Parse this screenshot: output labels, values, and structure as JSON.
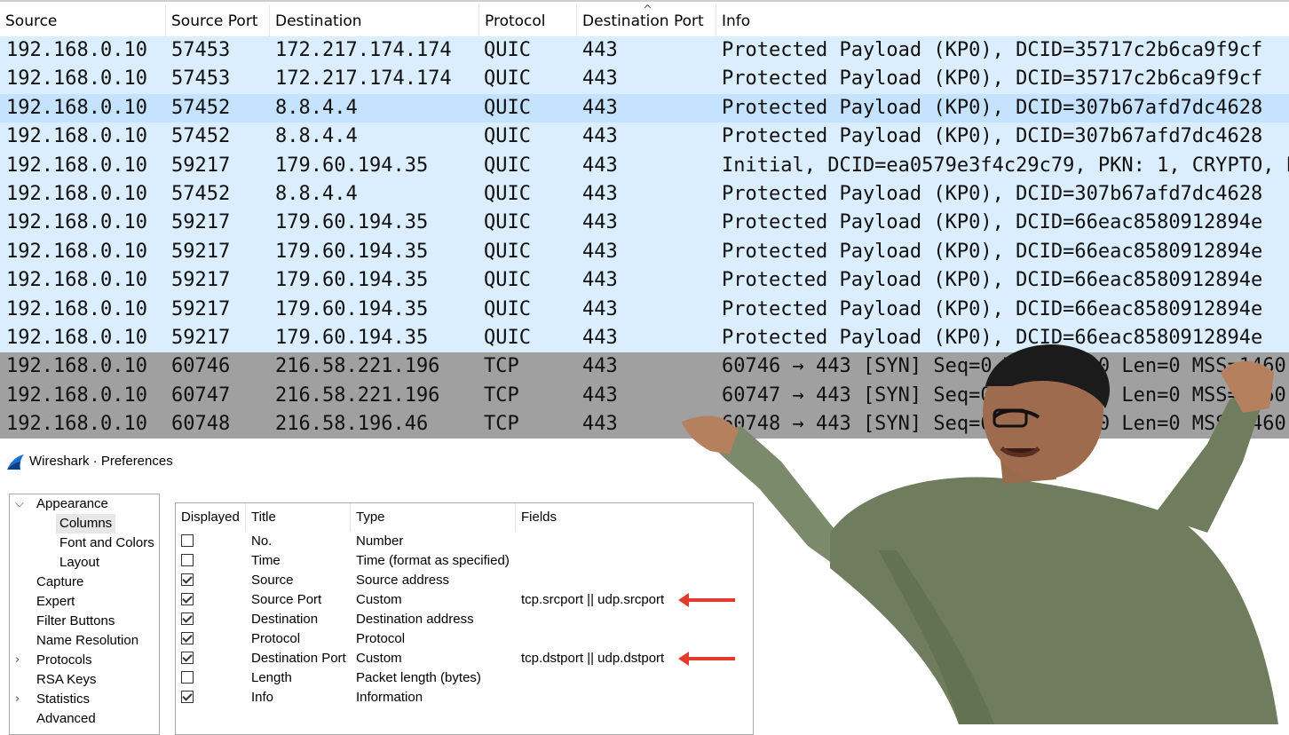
{
  "packet_list": {
    "columns": [
      "Source",
      "Source Port",
      "Destination",
      "Protocol",
      "Destination Port",
      "Info"
    ],
    "sort_indicator": "^",
    "rows": [
      {
        "source": "192.168.0.10",
        "source_port": "57453",
        "destination": "172.217.174.174",
        "protocol": "QUIC",
        "destination_port": "443",
        "info": "Protected Payload (KP0), DCID=35717c2b6ca9f9cf",
        "kind": "quic"
      },
      {
        "source": "192.168.0.10",
        "source_port": "57453",
        "destination": "172.217.174.174",
        "protocol": "QUIC",
        "destination_port": "443",
        "info": "Protected Payload (KP0), DCID=35717c2b6ca9f9cf",
        "kind": "quic"
      },
      {
        "source": "192.168.0.10",
        "source_port": "57452",
        "destination": "8.8.4.4",
        "protocol": "QUIC",
        "destination_port": "443",
        "info": "Protected Payload (KP0), DCID=307b67afd7dc4628",
        "kind": "quic-sel"
      },
      {
        "source": "192.168.0.10",
        "source_port": "57452",
        "destination": "8.8.4.4",
        "protocol": "QUIC",
        "destination_port": "443",
        "info": "Protected Payload (KP0), DCID=307b67afd7dc4628",
        "kind": "quic"
      },
      {
        "source": "192.168.0.10",
        "source_port": "59217",
        "destination": "179.60.194.35",
        "protocol": "QUIC",
        "destination_port": "443",
        "info": "Initial, DCID=ea0579e3f4c29c79, PKN: 1, CRYPTO, P",
        "kind": "quic"
      },
      {
        "source": "192.168.0.10",
        "source_port": "57452",
        "destination": "8.8.4.4",
        "protocol": "QUIC",
        "destination_port": "443",
        "info": "Protected Payload (KP0), DCID=307b67afd7dc4628",
        "kind": "quic"
      },
      {
        "source": "192.168.0.10",
        "source_port": "59217",
        "destination": "179.60.194.35",
        "protocol": "QUIC",
        "destination_port": "443",
        "info": "Protected Payload (KP0), DCID=66eac8580912894e",
        "kind": "quic"
      },
      {
        "source": "192.168.0.10",
        "source_port": "59217",
        "destination": "179.60.194.35",
        "protocol": "QUIC",
        "destination_port": "443",
        "info": "Protected Payload (KP0), DCID=66eac8580912894e",
        "kind": "quic"
      },
      {
        "source": "192.168.0.10",
        "source_port": "59217",
        "destination": "179.60.194.35",
        "protocol": "QUIC",
        "destination_port": "443",
        "info": "Protected Payload (KP0), DCID=66eac8580912894e",
        "kind": "quic"
      },
      {
        "source": "192.168.0.10",
        "source_port": "59217",
        "destination": "179.60.194.35",
        "protocol": "QUIC",
        "destination_port": "443",
        "info": "Protected Payload (KP0), DCID=66eac8580912894e",
        "kind": "quic"
      },
      {
        "source": "192.168.0.10",
        "source_port": "59217",
        "destination": "179.60.194.35",
        "protocol": "QUIC",
        "destination_port": "443",
        "info": "Protected Payload (KP0), DCID=66eac8580912894e",
        "kind": "quic"
      },
      {
        "source": "192.168.0.10",
        "source_port": "60746",
        "destination": "216.58.221.196",
        "protocol": "TCP",
        "destination_port": "443",
        "info": "60746 → 443 [SYN] Seq=0 Win=64240 Len=0 MSS=1460",
        "kind": "tcp"
      },
      {
        "source": "192.168.0.10",
        "source_port": "60747",
        "destination": "216.58.221.196",
        "protocol": "TCP",
        "destination_port": "443",
        "info": "60747 → 443 [SYN] Seq=0 Win=64240 Len=0 MSS=1460",
        "kind": "tcp"
      },
      {
        "source": "192.168.0.10",
        "source_port": "60748",
        "destination": "216.58.196.46",
        "protocol": "TCP",
        "destination_port": "443",
        "info": "60748 → 443 [SYN] Seq=0 Win=64240 Len=0 MSS=1460",
        "kind": "tcp"
      }
    ],
    "colors": {
      "quic": "#dbeeff",
      "quic_selected": "#c5e3ff",
      "tcp": "#a0a0a0"
    }
  },
  "prefs": {
    "window_title": "Wireshark · Preferences",
    "icon": "wireshark-fin-icon",
    "tree": [
      {
        "label": "Appearance",
        "caret": "expanded"
      },
      {
        "label": "Columns",
        "selected": true
      },
      {
        "label": "Font and Colors"
      },
      {
        "label": "Layout"
      },
      {
        "label": "Capture"
      },
      {
        "label": "Expert"
      },
      {
        "label": "Filter Buttons"
      },
      {
        "label": "Name Resolution"
      },
      {
        "label": "Protocols",
        "caret": "collapsed"
      },
      {
        "label": "RSA Keys"
      },
      {
        "label": "Statistics",
        "caret": "collapsed"
      },
      {
        "label": "Advanced"
      }
    ],
    "columns_table": {
      "headers": [
        "Displayed",
        "Title",
        "Type",
        "Fields"
      ],
      "rows": [
        {
          "displayed": false,
          "title": "No.",
          "type": "Number",
          "fields": ""
        },
        {
          "displayed": false,
          "title": "Time",
          "type": "Time (format as specified)",
          "fields": ""
        },
        {
          "displayed": true,
          "title": "Source",
          "type": "Source address",
          "fields": ""
        },
        {
          "displayed": true,
          "title": "Source Port",
          "type": "Custom",
          "fields": "tcp.srcport || udp.srcport",
          "highlight_arrow": true
        },
        {
          "displayed": true,
          "title": "Destination",
          "type": "Destination address",
          "fields": ""
        },
        {
          "displayed": true,
          "title": "Protocol",
          "type": "Protocol",
          "fields": ""
        },
        {
          "displayed": true,
          "title": "Destination Port",
          "type": "Custom",
          "fields": "tcp.dstport || udp.dstport",
          "highlight_arrow": true
        },
        {
          "displayed": false,
          "title": "Length",
          "type": "Packet length (bytes)",
          "fields": ""
        },
        {
          "displayed": true,
          "title": "Info",
          "type": "Information",
          "fields": ""
        }
      ]
    },
    "arrow_color": "#e23b2e"
  }
}
